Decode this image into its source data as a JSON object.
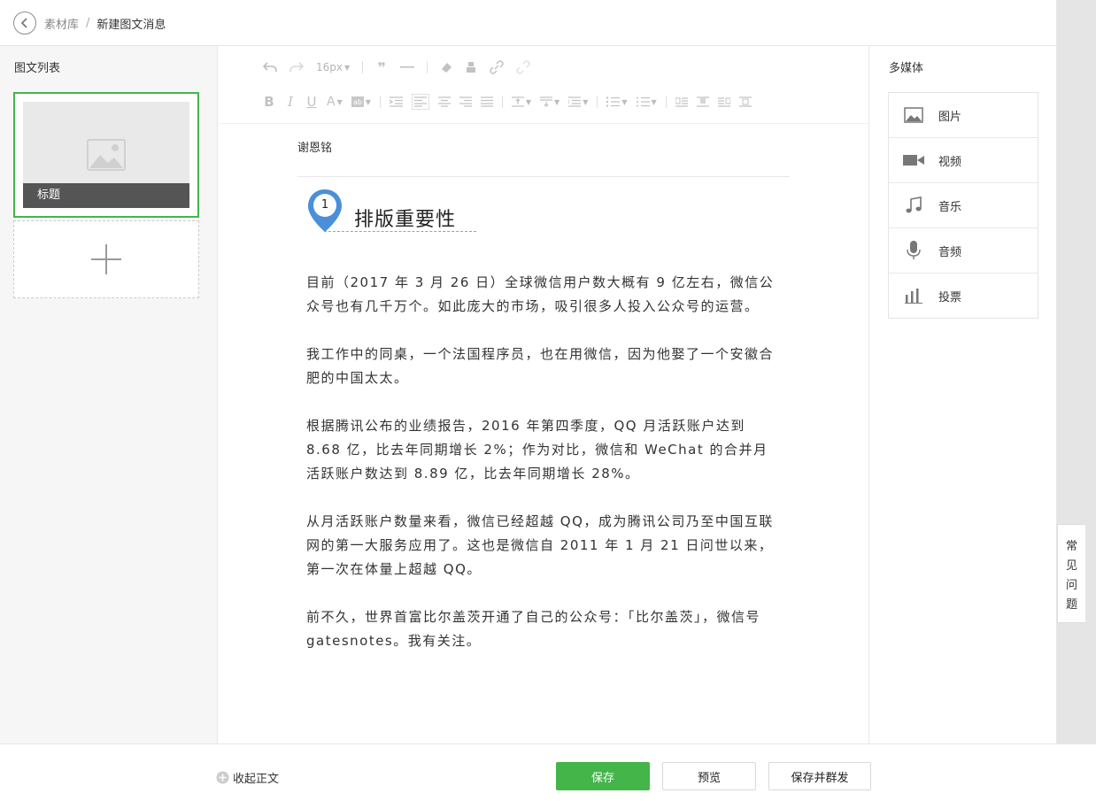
{
  "header": {
    "breadcrumb_root": "素材库",
    "breadcrumb_sep": "/",
    "breadcrumb_current": "新建图文消息"
  },
  "left_panel": {
    "title": "图文列表",
    "articles": [
      {
        "title": "标题",
        "selected": true
      }
    ]
  },
  "toolbar": {
    "font_size": "16px"
  },
  "editor": {
    "author": "谢恩铭",
    "section_number": "1",
    "section_heading": "排版重要性",
    "paragraphs": [
      "目前（2017 年 3 月 26 日）全球微信用户数大概有 9 亿左右，微信公众号也有几千万个。如此庞大的市场，吸引很多人投入公众号的运营。",
      "我工作中的同桌，一个法国程序员，也在用微信，因为他娶了一个安徽合肥的中国太太。",
      "根据腾讯公布的业绩报告，2016 年第四季度，QQ 月活跃账户达到 8.68 亿，比去年同期增长 2%；作为对比，微信和 WeChat 的合并月活跃账户数达到 8.89 亿，比去年同期增长 28%。",
      "从月活跃账户数量来看，微信已经超越 QQ，成为腾讯公司乃至中国互联网的第一大服务应用了。这也是微信自 2011 年 1 月 21 日问世以来，第一次在体量上超越 QQ。",
      "前不久，世界首富比尔盖茨开通了自己的公众号：「比尔盖茨」，微信号 gatesnotes。我有关注。"
    ]
  },
  "media": {
    "title": "多媒体",
    "items": [
      {
        "label": "图片",
        "icon": "image-icon"
      },
      {
        "label": "视频",
        "icon": "video-icon"
      },
      {
        "label": "音乐",
        "icon": "music-icon"
      },
      {
        "label": "音频",
        "icon": "microphone-icon"
      },
      {
        "label": "投票",
        "icon": "poll-icon"
      }
    ]
  },
  "faq": {
    "chars": [
      "常",
      "见",
      "问",
      "题"
    ]
  },
  "footer": {
    "collapse_label": "收起正文",
    "save_label": "保存",
    "preview_label": "预览",
    "save_send_label": "保存并群发"
  },
  "colors": {
    "accent": "#44b549",
    "pin": "#4a8fd8"
  }
}
